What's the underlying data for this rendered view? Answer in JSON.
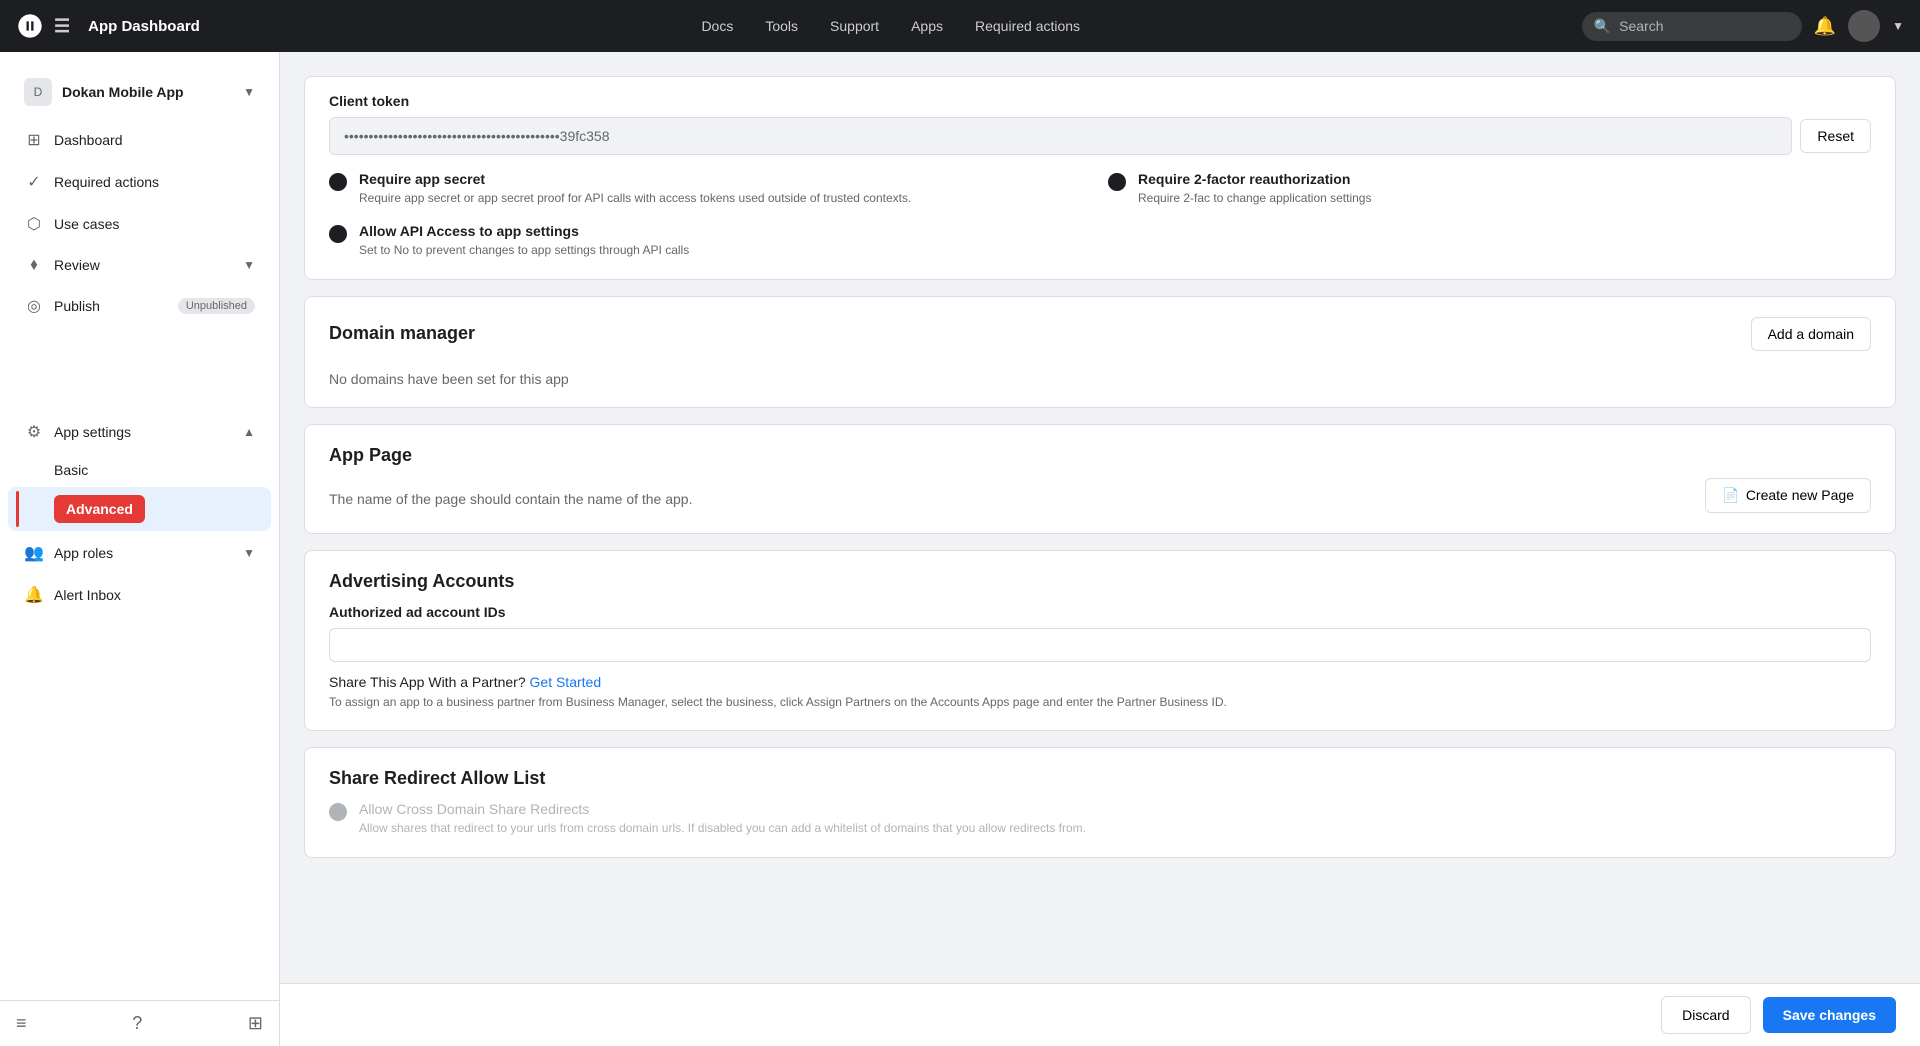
{
  "topNav": {
    "logo": "Meta",
    "appTitle": "App Dashboard",
    "links": [
      "Docs",
      "Tools",
      "Support",
      "Apps",
      "Required actions"
    ],
    "search": {
      "placeholder": "Search"
    }
  },
  "sidebar": {
    "appName": "Dokan Mobile App",
    "navItems": [
      {
        "id": "dashboard",
        "label": "Dashboard",
        "icon": "⊞"
      },
      {
        "id": "required-actions",
        "label": "Required actions",
        "icon": "✓"
      },
      {
        "id": "use-cases",
        "label": "Use cases",
        "icon": "⬡"
      },
      {
        "id": "review",
        "label": "Review",
        "icon": "⬧",
        "hasChevron": true
      },
      {
        "id": "publish",
        "label": "Publish",
        "icon": "◎",
        "badge": "Unpublished"
      }
    ],
    "appSettings": {
      "label": "App settings",
      "icon": "⚙",
      "subItems": [
        {
          "id": "basic",
          "label": "Basic"
        },
        {
          "id": "advanced",
          "label": "Advanced",
          "active": true
        }
      ]
    },
    "appRoles": {
      "label": "App roles",
      "icon": "👥",
      "hasChevron": true
    },
    "alertInbox": {
      "label": "Alert Inbox",
      "icon": "🔔"
    },
    "bottomIcons": [
      "≡",
      "?",
      "⊞"
    ]
  },
  "content": {
    "clientToken": {
      "label": "Client token",
      "tokenValue": "••••••••••••••••••••••••••••••••••••••••••••39fc358",
      "resetButton": "Reset"
    },
    "securityOptions": {
      "option1": {
        "title": "Require app secret",
        "description": "Require app secret or app secret proof for API calls with access tokens used outside of trusted contexts."
      },
      "option2": {
        "title": "Require 2-factor reauthorization",
        "description": "Require 2-fac to change application settings"
      },
      "option3": {
        "title": "Allow API Access to app settings",
        "description": "Set to No to prevent changes to app settings through API calls"
      }
    },
    "domainManager": {
      "title": "Domain manager",
      "addButton": "Add a domain",
      "emptyText": "No domains have been set for this app"
    },
    "appPage": {
      "title": "App Page",
      "description": "The name of the page should contain the name of the app.",
      "createButton": "Create new Page"
    },
    "advertisingAccounts": {
      "title": "Advertising Accounts",
      "label": "Authorized ad account IDs",
      "partnerText": "Share This App With a Partner?",
      "partnerLink": "Get Started",
      "partnerDesc": "To assign an app to a business partner from Business Manager, select the business, click Assign Partners on the Accounts Apps page and enter the Partner Business ID."
    },
    "shareRedirect": {
      "title": "Share Redirect Allow List",
      "option": {
        "title": "Allow Cross Domain Share Redirects",
        "description": "Allow shares that redirect to your urls from cross domain urls. If disabled you can add a whitelist of domains that you allow redirects from."
      }
    }
  },
  "bottomBar": {
    "discardLabel": "Discard",
    "saveLabel": "Save changes"
  }
}
